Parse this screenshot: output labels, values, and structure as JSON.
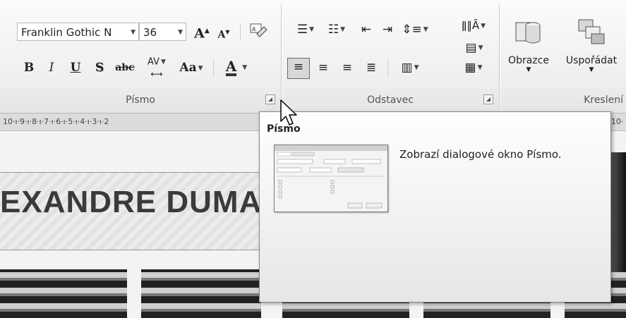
{
  "ribbon": {
    "font": {
      "name_value": "Franklin Gothic N",
      "size_value": "36",
      "grow_label": "A",
      "shrink_label": "A",
      "clear_label": "A",
      "bold_label": "B",
      "italic_label": "I",
      "underline_label": "U",
      "shadow_label": "S",
      "strike_label": "abc",
      "spacing_label": "AV",
      "case_label": "Aa",
      "color_label": "A",
      "group_label": "Písmo"
    },
    "paragraph": {
      "group_label": "Odstavec"
    },
    "drawing": {
      "shapes_label": "Obrazce",
      "arrange_label": "Uspořádat",
      "group_label": "Kreslení"
    }
  },
  "ruler": {
    "text": "10·ı·9·ı·8·ı·7·ı·6·ı·5·ı·4·ı·3·ı·2",
    "right_text": "10·"
  },
  "slide": {
    "title": "EXANDRE DUMA"
  },
  "tooltip": {
    "title": "Písmo",
    "description": "Zobrazí dialogové okno Písmo."
  }
}
